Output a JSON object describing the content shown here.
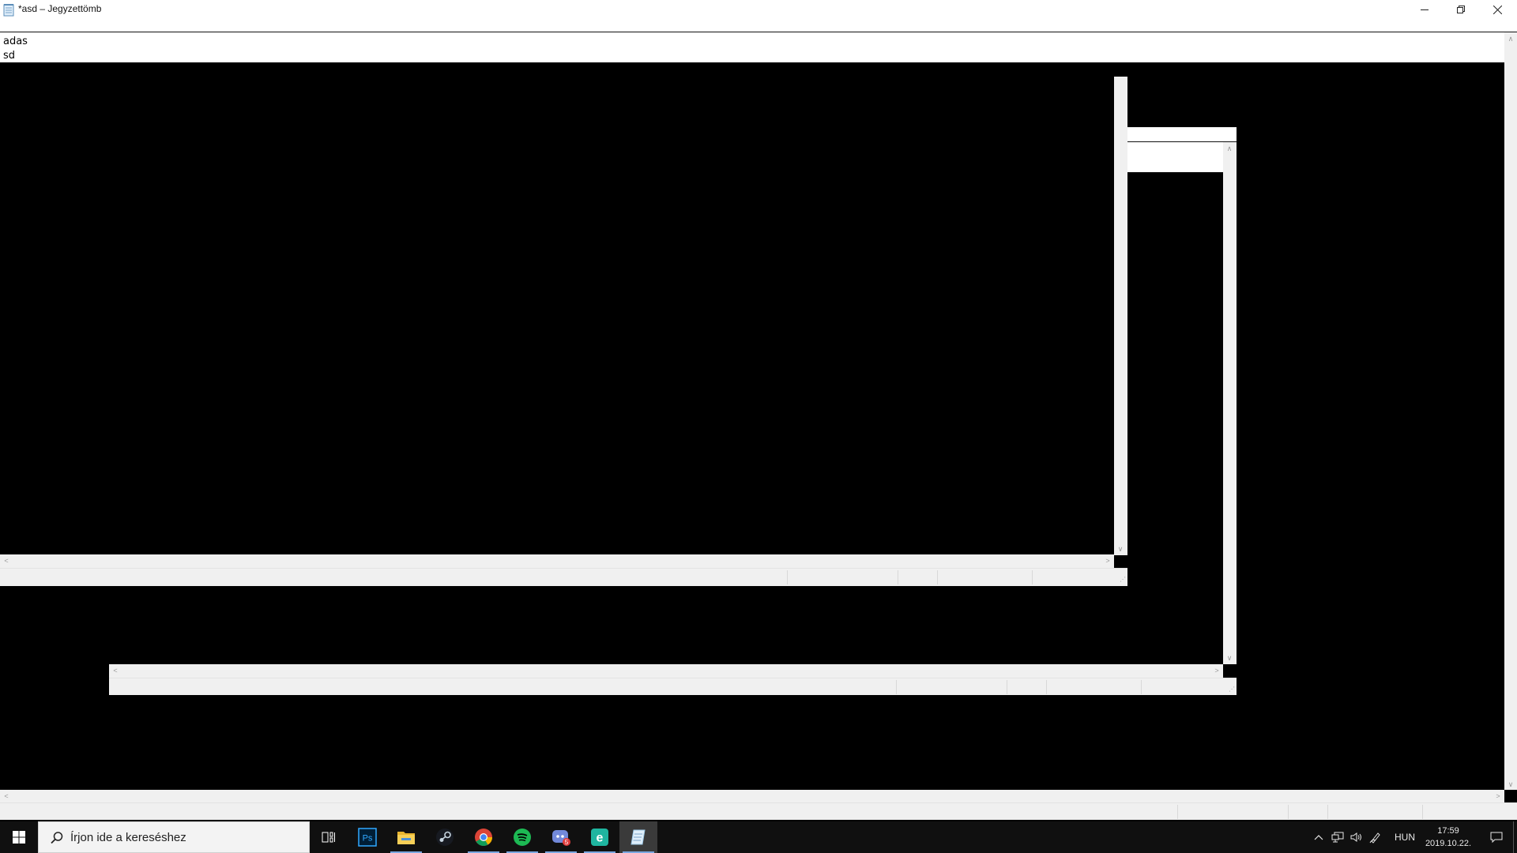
{
  "window": {
    "title": "*asd – Jegyzettömb",
    "controls": {
      "minimize_icon": "minimize-icon",
      "restore_icon": "restore-icon",
      "close_icon": "close-icon"
    }
  },
  "editor": {
    "content": "adas\nsd"
  },
  "scrollbars": {
    "up": "∧",
    "down": "∨",
    "left": "<",
    "right": ">"
  },
  "statusbar_grip": "⋰",
  "taskbar": {
    "search_placeholder": "Írjon ide a kereséshez",
    "apps": [
      {
        "name": "Photoshop",
        "label": "Ps",
        "color": "#31a8ff"
      },
      {
        "name": "File Explorer",
        "color": "#f2c94c"
      },
      {
        "name": "Steam",
        "color": "#c7d5e0"
      },
      {
        "name": "Chrome",
        "color": "#4285f4"
      },
      {
        "name": "Spotify",
        "color": "#1db954"
      },
      {
        "name": "Discord",
        "badge": "5",
        "color": "#7289da"
      },
      {
        "name": "App",
        "label": "e",
        "color": "#1fb5a0"
      },
      {
        "name": "Notepad",
        "color": "#9ec9e8"
      }
    ],
    "tray": {
      "language": "HUN",
      "time": "17:59",
      "date": "2019.10.22."
    }
  }
}
